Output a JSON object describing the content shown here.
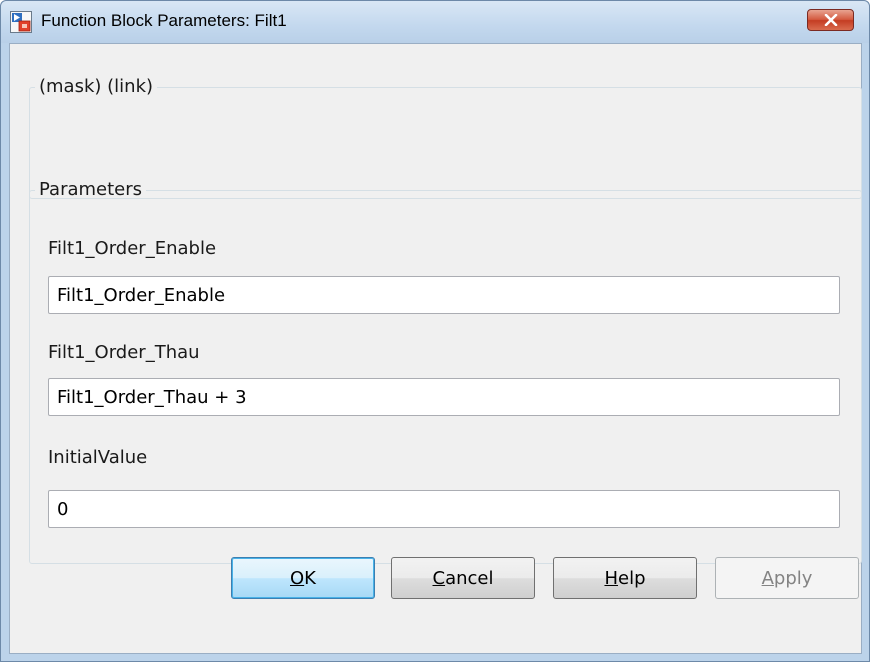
{
  "window": {
    "title": "Function Block Parameters: Filt1"
  },
  "mask_group": {
    "label": "(mask) (link)"
  },
  "parameters_group": {
    "label": "Parameters",
    "fields": [
      {
        "label": "Filt1_Order_Enable",
        "value": "Filt1_Order_Enable"
      },
      {
        "label": "Filt1_Order_Thau",
        "value": "Filt1_Order_Thau + 3"
      },
      {
        "label": "InitialValue",
        "value": "0"
      }
    ]
  },
  "buttons": {
    "ok": {
      "mnemonic": "O",
      "rest": "K"
    },
    "cancel": {
      "mnemonic": "C",
      "rest": "ancel"
    },
    "help": {
      "mnemonic": "H",
      "rest": "elp"
    },
    "apply": {
      "mnemonic": "A",
      "rest": "pply",
      "disabled": true
    }
  },
  "icons": {
    "app": "simulink-block-icon",
    "close": "close-icon"
  },
  "colors": {
    "titlebar": "#c3d8ee",
    "close_button": "#c43c22",
    "dialog_background": "#f0f0f0",
    "default_button_border": "#3c7fb1"
  }
}
